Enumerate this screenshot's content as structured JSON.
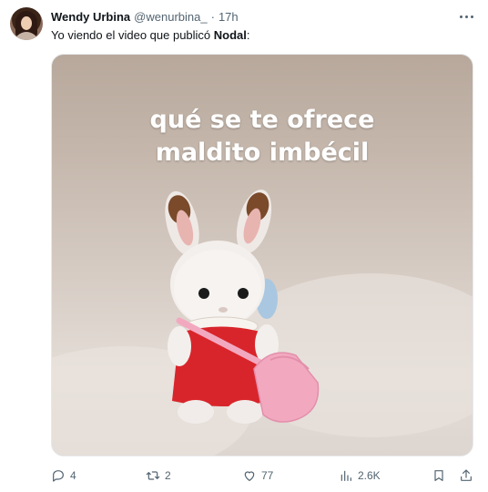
{
  "author": {
    "name": "Wendy Urbina",
    "handle": "@wenurbina_",
    "separator": "·",
    "time": "17h"
  },
  "post": {
    "text_prefix": "Yo viendo el video que publicó ",
    "text_bold": "Nodal",
    "text_suffix": ":"
  },
  "media": {
    "caption_line1": "qué se te ofrece",
    "caption_line2": "maldito imbécil"
  },
  "actions": {
    "replies": "4",
    "reposts": "2",
    "likes": "77",
    "views": "2.6K"
  },
  "colors": {
    "text": "#0f1419",
    "secondary": "#536471",
    "bunny_dress": "#d8252b",
    "bag": "#f2a9c0"
  },
  "icons": [
    "more-icon",
    "reply-icon",
    "repost-icon",
    "like-icon",
    "views-icon",
    "bookmark-icon",
    "share-icon"
  ]
}
